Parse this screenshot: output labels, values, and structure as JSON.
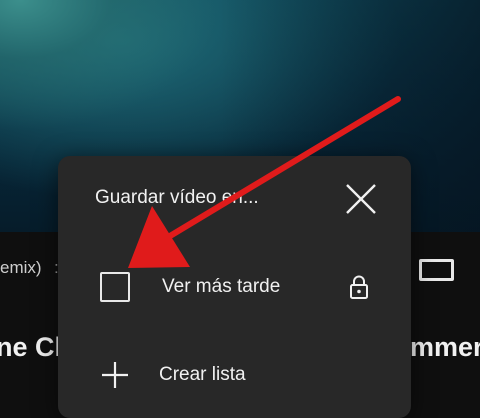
{
  "background": {
    "meta_text": "emix)",
    "meta_separator": ":",
    "title_left": "ne Ch",
    "title_right": "mmer"
  },
  "dialog": {
    "title": "Guardar vídeo en...",
    "close_icon": "close-icon",
    "playlists": [
      {
        "label": "Ver más tarde",
        "checked": false,
        "privacy_icon": "lock-icon"
      }
    ],
    "create_label": "Crear lista",
    "create_icon": "plus-icon"
  },
  "annotation": {
    "arrow_color": "#e01b1b"
  },
  "colors": {
    "dialog_bg": "#282828",
    "text": "#f1f1f1"
  }
}
